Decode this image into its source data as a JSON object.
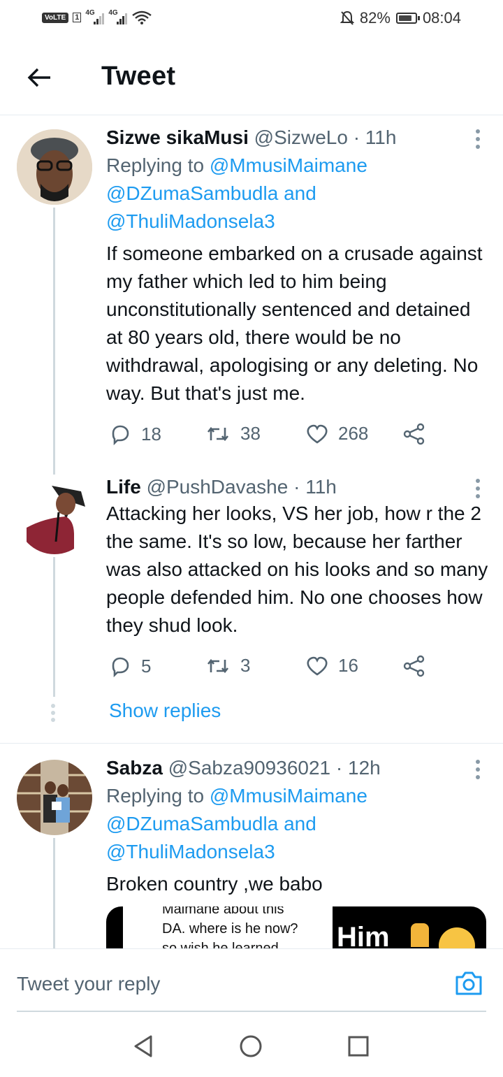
{
  "status_bar": {
    "volte": "VoLTE",
    "sim": "1",
    "net1": "4G",
    "net2": "4G",
    "battery_percent": "82%",
    "battery_level": 0.82,
    "time": "08:04"
  },
  "header": {
    "title": "Tweet"
  },
  "tweets": [
    {
      "name": "Sizwe sikaMusi",
      "handle": "@SizweLo",
      "time": "· 11h",
      "replying_label": "Replying to",
      "replying_1": "@MmusiMaimane",
      "replying_2": "@DZumaSambudla",
      "replying_and": "and",
      "replying_3": "@ThuliMadonsela3",
      "text": "If someone embarked on a crusade against my father which led to him being unconstitutionally sentenced and detained at 80 years old, there would be no withdrawal, apologising or any deleting. No way. But that's just me.",
      "replies": "18",
      "retweets": "38",
      "likes": "268"
    },
    {
      "name": "Life",
      "handle": "@PushDavashe",
      "time": "· 11h",
      "text": "Attacking her looks, VS her job, how r the 2 the same. It's so low, because her farther was also attacked on his looks and so many people defended him. No one chooses how they shud look.",
      "replies": "5",
      "retweets": "3",
      "likes": "16"
    },
    {
      "name": "Sabza",
      "handle": "@Sabza90936021",
      "time": "· 12h",
      "replying_label": "Replying to",
      "replying_1": "@MmusiMaimane",
      "replying_2": "@DZumaSambudla",
      "replying_and": "and",
      "replying_3": "@ThuliMadonsela3",
      "text": "Broken country ,we babo",
      "media_line1": "Maimane about this",
      "media_line2": "DA. where is he now?",
      "media_line3": "so wish he learned",
      "media_right": "Him"
    }
  ],
  "show_replies": "Show replies",
  "reply_bar": {
    "placeholder": "Tweet your reply"
  },
  "icons": {
    "back": "arrow-left-icon",
    "camera": "camera-icon",
    "reply": "reply-icon",
    "retweet": "retweet-icon",
    "like": "heart-icon",
    "share": "share-icon"
  },
  "colors": {
    "link": "#1d9bf0",
    "muted": "#536471",
    "thread_line": "#cfd9de"
  }
}
